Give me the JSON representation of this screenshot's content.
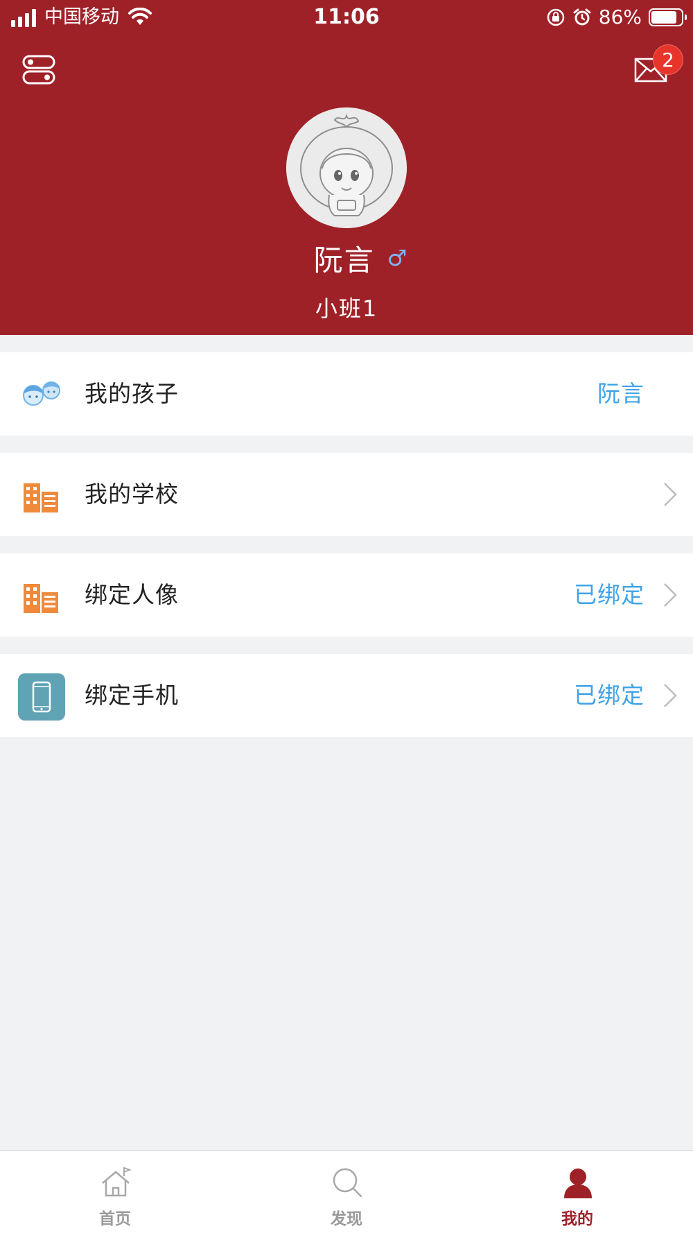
{
  "status_bar": {
    "carrier": "中国移动",
    "time": "11:06",
    "battery_percent": "86%",
    "battery_level": 0.86
  },
  "header": {
    "background_color": "#9f2128",
    "message_badge_count": "2",
    "profile": {
      "name": "阮言",
      "gender_symbol": "♂",
      "class_name": "小班1"
    }
  },
  "menu": {
    "items": [
      {
        "label": "我的孩子",
        "value": "阮言",
        "icon": "children-icon",
        "chevron": false
      },
      {
        "label": "我的学校",
        "value": "",
        "icon": "school-building-icon",
        "chevron": true
      },
      {
        "label": "绑定人像",
        "value": "已绑定",
        "icon": "school-building-icon",
        "chevron": true
      },
      {
        "label": "绑定手机",
        "value": "已绑定",
        "icon": "phone-icon",
        "chevron": true
      }
    ],
    "value_color": "#3fa3e6"
  },
  "tabbar": {
    "active_color": "#9f2128",
    "inactive_color": "#9a9a9a",
    "tabs": [
      {
        "label": "首页",
        "icon": "home-icon",
        "active": false
      },
      {
        "label": "发现",
        "icon": "search-icon",
        "active": false
      },
      {
        "label": "我的",
        "icon": "profile-icon",
        "active": true
      }
    ]
  }
}
